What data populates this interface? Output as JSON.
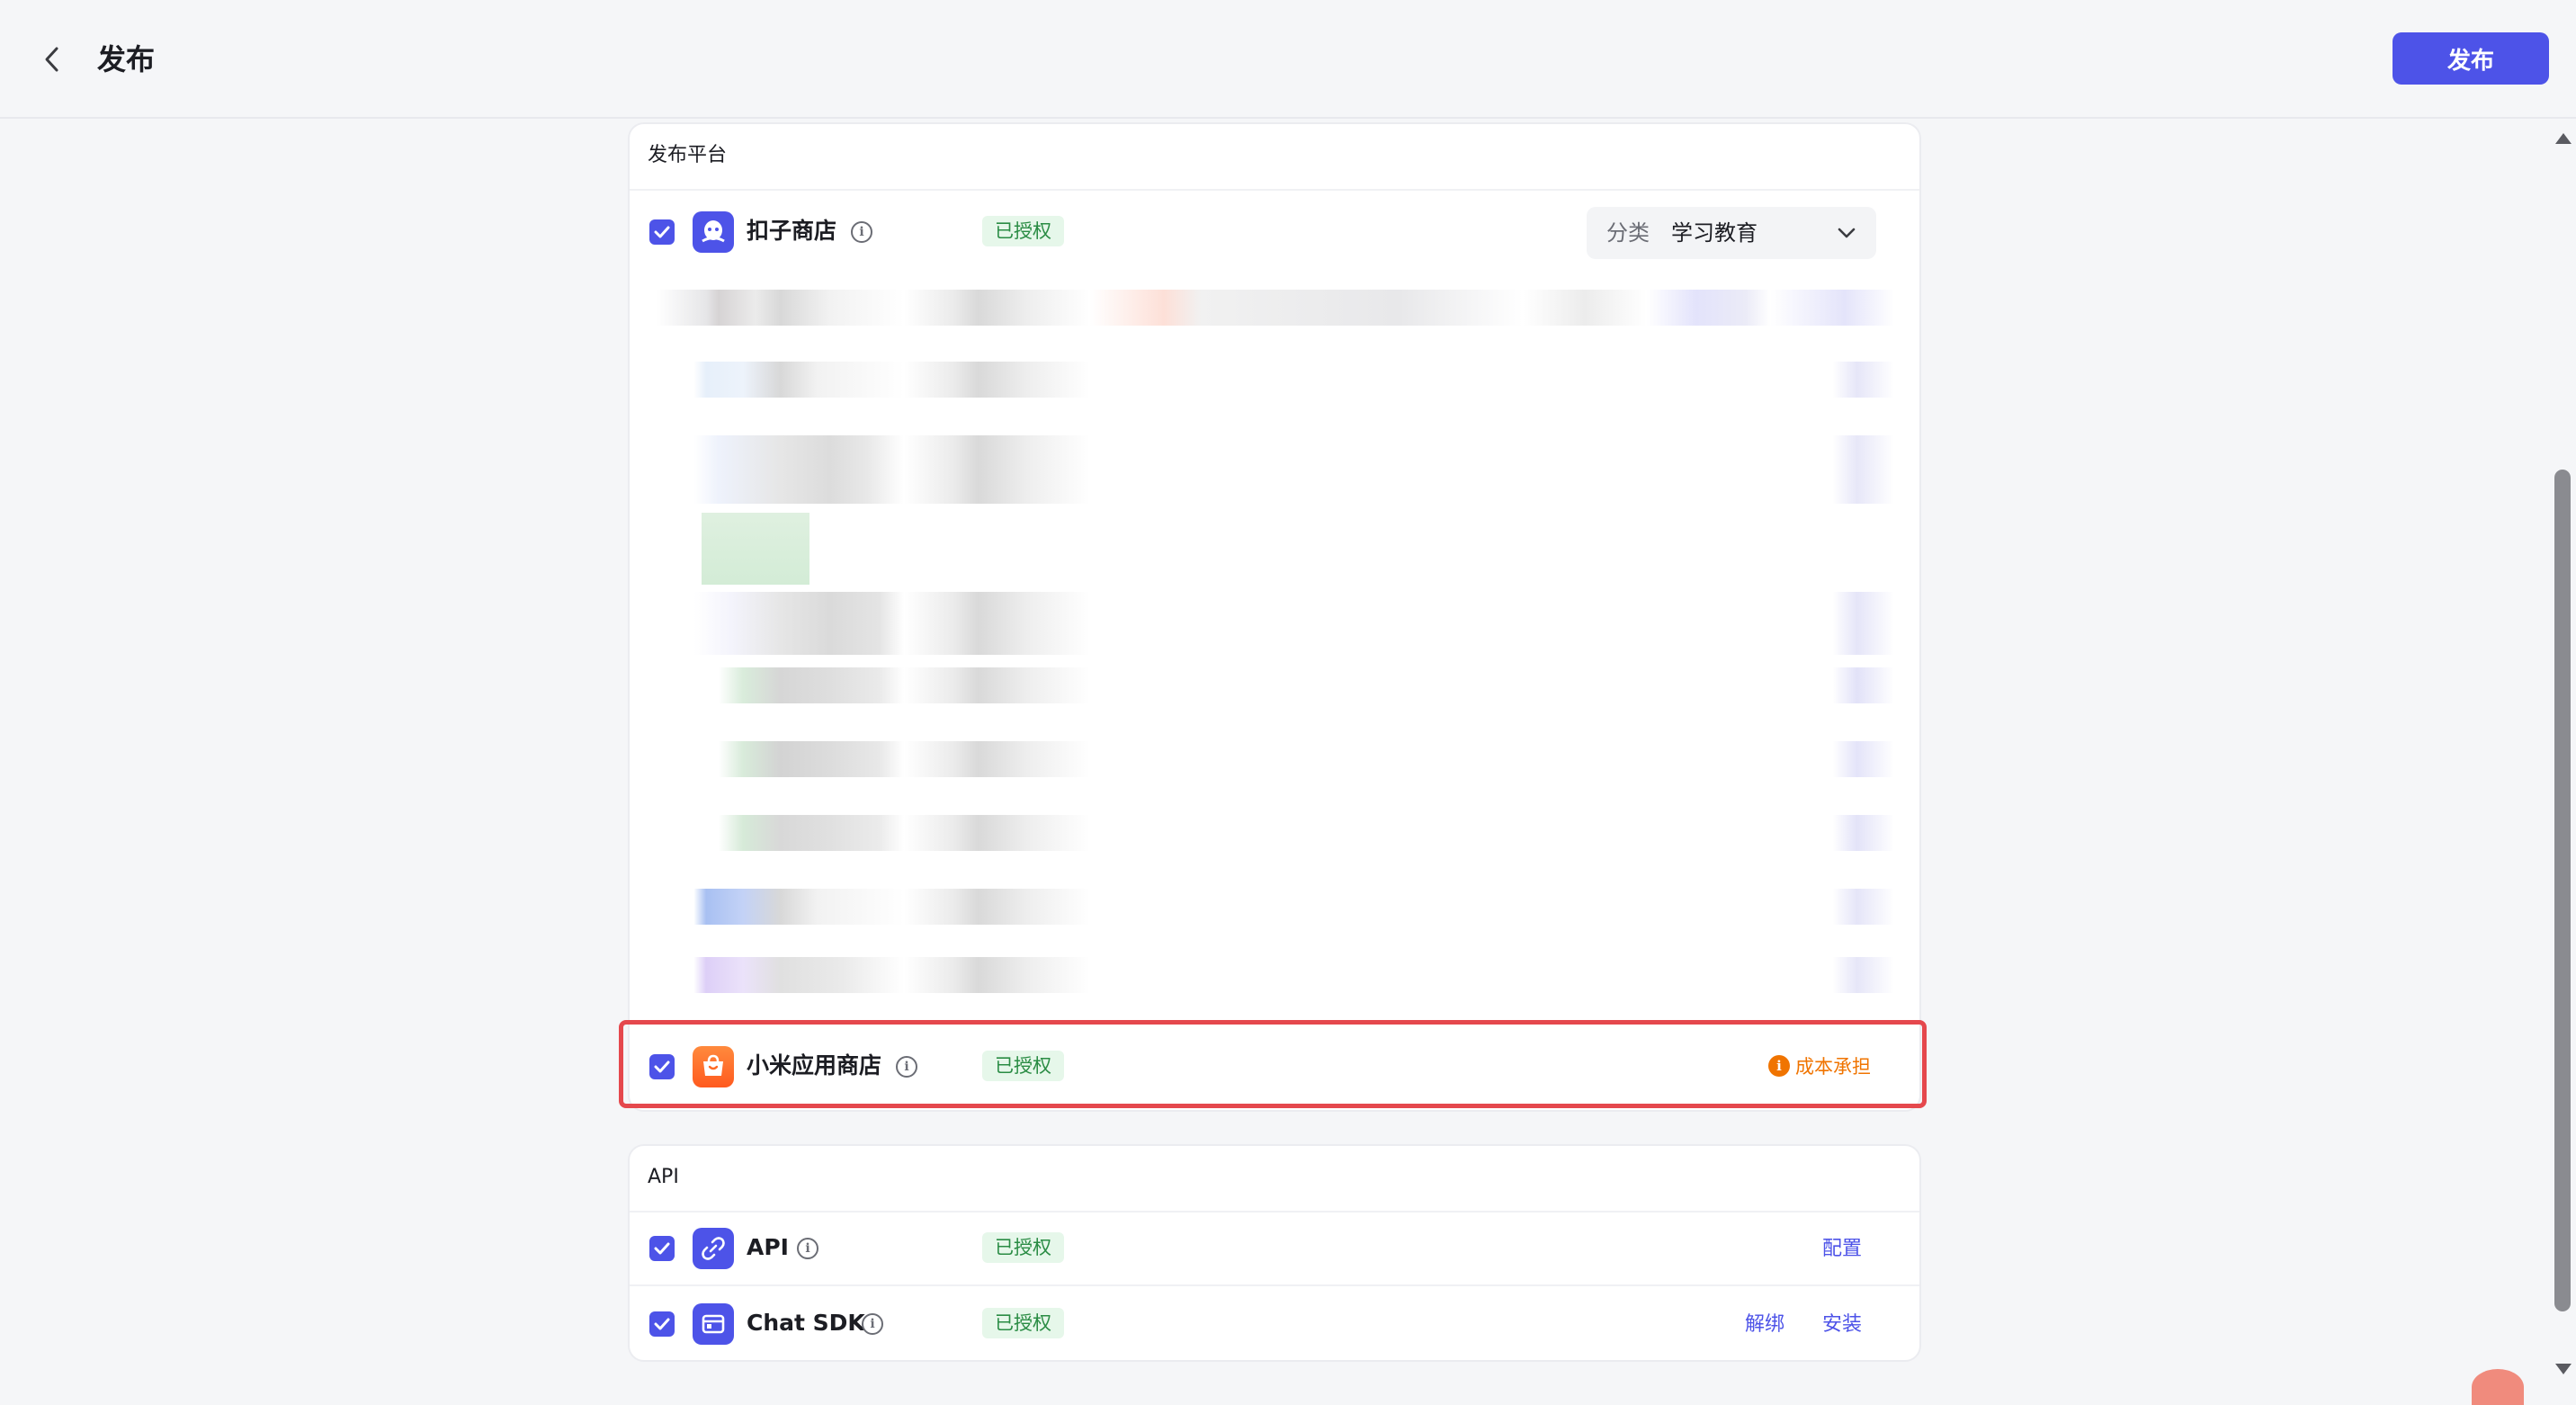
{
  "header": {
    "title": "发布",
    "publish_label": "发布"
  },
  "platforms": {
    "section_title": "发布平台",
    "coze_store": {
      "name": "扣子商店",
      "status": "已授权",
      "category_label": "分类",
      "category_value": "学习教育"
    },
    "xiaomi_store": {
      "name": "小米应用商店",
      "status": "已授权",
      "cost_label": "成本承担"
    }
  },
  "api_section": {
    "section_title": "API",
    "rows": [
      {
        "name": "API",
        "status": "已授权",
        "action": "配置"
      },
      {
        "name": "Chat SDK",
        "status": "已授权",
        "action_unbind": "解绑",
        "action_install": "安装"
      }
    ]
  },
  "colors": {
    "accent": "#4d53e8",
    "authorized_bg": "#e6f7ea",
    "authorized_text": "#2a8c44",
    "warning": "#f07400",
    "highlight": "#e5484d"
  },
  "icons": [
    "back-icon",
    "coze-store-icon",
    "xiaomi-store-icon",
    "api-link-icon",
    "chat-sdk-icon",
    "info-icon",
    "chevron-down-icon",
    "warning-icon",
    "check-icon"
  ]
}
